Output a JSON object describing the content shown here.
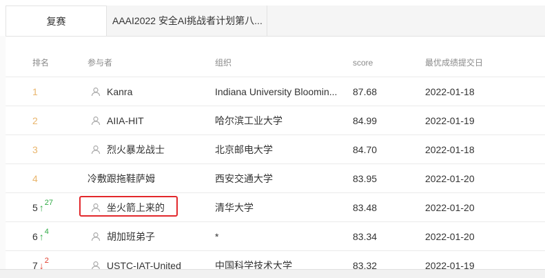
{
  "tabs": [
    {
      "label": "复赛",
      "active": true
    },
    {
      "label": "AAAI2022 安全AI挑战者计划第八...",
      "active": false
    }
  ],
  "table": {
    "headers": {
      "rank": "排名",
      "participant": "参与者",
      "org": "组织",
      "score": "score",
      "date": "最优成绩提交日"
    },
    "rows": [
      {
        "rank": "1",
        "participant": "Kanra",
        "org": "Indiana University Bloomin...",
        "score": "87.68",
        "date": "2022-01-18",
        "icon": "user-icon"
      },
      {
        "rank": "2",
        "participant": "AIIA-HIT",
        "org": "哈尔滨工业大学",
        "score": "84.99",
        "date": "2022-01-19",
        "icon": "user-icon"
      },
      {
        "rank": "3",
        "participant": "烈火暴龙战士",
        "org": "北京邮电大学",
        "score": "84.70",
        "date": "2022-01-18",
        "icon": "user-icon"
      },
      {
        "rank": "4",
        "participant": "冷敷跟拖鞋萨姆",
        "org": "西安交通大学",
        "score": "83.95",
        "date": "2022-01-20"
      },
      {
        "rank": "5",
        "delta": "27",
        "trend": "up",
        "participant": "坐火箭上来的",
        "org": "清华大学",
        "score": "83.48",
        "date": "2022-01-20",
        "icon": "user-icon",
        "highlighted": true
      },
      {
        "rank": "6",
        "delta": "4",
        "trend": "up",
        "participant": "胡加班弟子",
        "org": "*",
        "score": "83.34",
        "date": "2022-01-20",
        "icon": "user-icon"
      },
      {
        "rank": "7",
        "delta": "2",
        "trend": "down",
        "participant": "USTC-IAT-United",
        "org": "中国科学技术大学",
        "score": "83.32",
        "date": "2022-01-19",
        "icon": "user-icon"
      }
    ]
  },
  "colors": {
    "top_rank": "#e9b56c",
    "up": "#2faa44",
    "down": "#e03c2c",
    "highlight": "#e2272b"
  }
}
